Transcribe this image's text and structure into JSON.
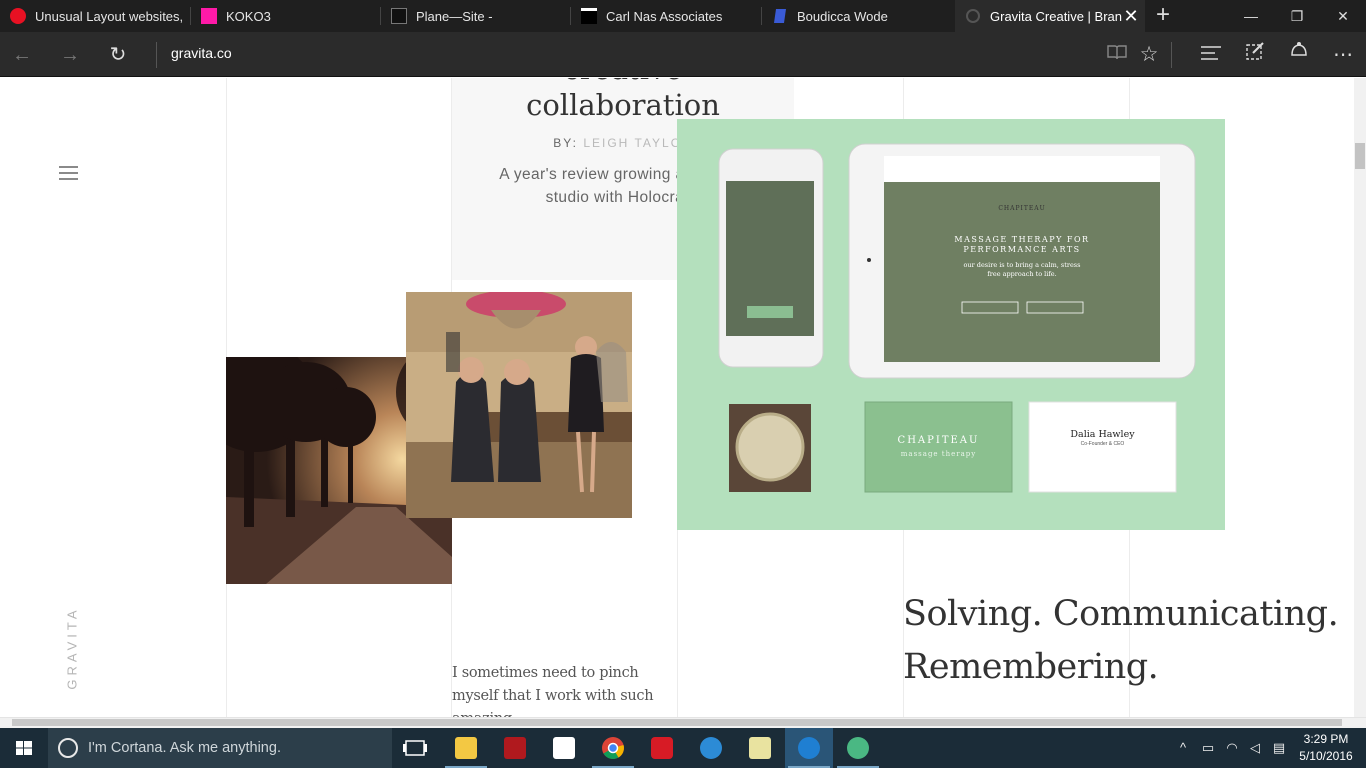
{
  "browser": {
    "tabs": [
      {
        "title": "Unusual Layout websites,",
        "favicon_color": "#e81123"
      },
      {
        "title": "KOKO3",
        "favicon_color": "#ff1aa8"
      },
      {
        "title": "Plane—Site -",
        "favicon_color": "#111111"
      },
      {
        "title": "Carl Nas Associates",
        "favicon_color": "#000000"
      },
      {
        "title": "Boudicca Wode",
        "favicon_color": "#3a5bd6"
      },
      {
        "title": "Gravita Creative | Bran",
        "favicon_color": "#3a3a3a",
        "active": true
      }
    ],
    "tab_close": "✕",
    "new_tab": "+",
    "window_controls": {
      "minimize": "—",
      "restore": "❐",
      "close": "✕"
    },
    "nav": {
      "back": "←",
      "forward": "→",
      "refresh": "↻"
    },
    "address": "gravita.co",
    "toolbar_icons": [
      "reading-view-icon",
      "favorite-star-icon",
      "hub-icon",
      "web-note-icon",
      "share-icon",
      "more-icon"
    ],
    "toolbar_glyphs": {
      "star": "☆",
      "hub": "≡",
      "more": "⋯"
    }
  },
  "page": {
    "brand_vertical": "GRAVITA",
    "card": {
      "title_partial": "creative",
      "title": "collaboration",
      "by_label": "BY:",
      "author": "LEIGH TAYLOR",
      "description": "A year's review growing a creative studio with Holocracy"
    },
    "mockup": {
      "brand": "CHAPITEAU",
      "hero_title": "MASSAGE THERAPY FOR PERFORMANCE ARTS",
      "hero_sub": "our desire is to bring a calm, stress free approach to life.",
      "card_sub": "massage therapy",
      "person_name": "Dalia Hawley",
      "person_title": "Co-Founder & CEO",
      "background": "#b4e0bd"
    },
    "headline": [
      "Solving. Communicating.",
      "Remembering."
    ],
    "quote": "I sometimes need to pinch myself that I work with such amazing"
  },
  "taskbar": {
    "search_placeholder": "I'm Cortana. Ask me anything.",
    "apps": [
      "task-view",
      "file-explorer",
      "app-red",
      "store",
      "chrome",
      "creative-cloud",
      "app-blue",
      "app-folder",
      "edge",
      "atom"
    ],
    "time": "3:29 PM",
    "date": "5/10/2016"
  }
}
